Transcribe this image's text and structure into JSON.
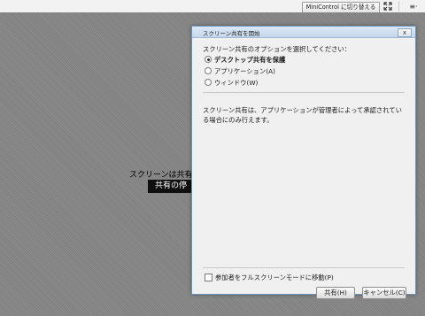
{
  "topbar": {
    "minicontrol_label": "MiniControl に切り替える",
    "fullscreen_icon": "fullscreen-icon",
    "menu_icon_glyph": "≡·"
  },
  "stage": {
    "message": "スクリーンは共有",
    "stop_button_label": "共有の停"
  },
  "dialog": {
    "title": "スクリーン共有を開始",
    "close_glyph": "x",
    "prompt": "スクリーン共有のオプションを選択してください：",
    "options": [
      {
        "label": "デスクトップ共有を保護",
        "selected": true
      },
      {
        "label": "アプリケーション(A)",
        "selected": false
      },
      {
        "label": "ウィンドウ(W)",
        "selected": false
      }
    ],
    "note": "スクリーン共有は、アプリケーションが管理者によって承認されている場合にのみ行えます。",
    "fullscreen_checkbox_label": "参加者をフルスクリーンモードに移動(P)",
    "share_button": "共有(H)",
    "cancel_button": "キャンセル(C)"
  }
}
